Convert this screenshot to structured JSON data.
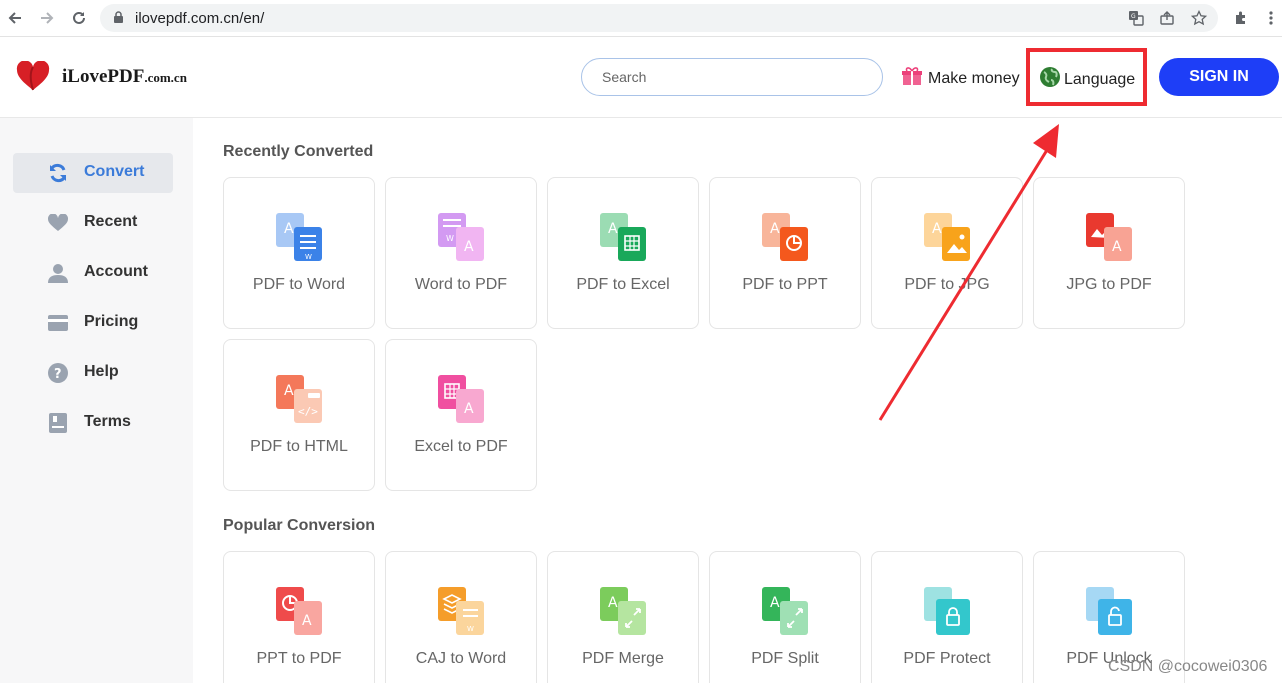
{
  "browser": {
    "url": "ilovepdf.com.cn/en/"
  },
  "header": {
    "logo_name": "iLovePDF",
    "logo_domain": ".com.cn",
    "search_placeholder": "Search",
    "make_money": "Make money",
    "language": "Language",
    "sign_in": "SIGN IN"
  },
  "sidebar": {
    "items": [
      {
        "label": "Convert",
        "icon": "refresh-icon"
      },
      {
        "label": "Recent",
        "icon": "heart-icon"
      },
      {
        "label": "Account",
        "icon": "user-icon"
      },
      {
        "label": "Pricing",
        "icon": "card-icon"
      },
      {
        "label": "Help",
        "icon": "help-icon"
      },
      {
        "label": "Terms",
        "icon": "document-icon"
      }
    ]
  },
  "main": {
    "recent_title": "Recently Converted",
    "recent": [
      {
        "label": "PDF to Word",
        "icon": "pdf-to-word-icon"
      },
      {
        "label": "Word to PDF",
        "icon": "word-to-pdf-icon"
      },
      {
        "label": "PDF to Excel",
        "icon": "pdf-to-excel-icon"
      },
      {
        "label": "PDF to PPT",
        "icon": "pdf-to-ppt-icon"
      },
      {
        "label": "PDF to JPG",
        "icon": "pdf-to-jpg-icon"
      },
      {
        "label": "JPG to PDF",
        "icon": "jpg-to-pdf-icon"
      },
      {
        "label": "PDF to HTML",
        "icon": "pdf-to-html-icon"
      },
      {
        "label": "Excel to PDF",
        "icon": "excel-to-pdf-icon"
      }
    ],
    "popular_title": "Popular Conversion",
    "popular": [
      {
        "label": "PPT to PDF",
        "icon": "ppt-to-pdf-icon"
      },
      {
        "label": "CAJ to Word",
        "icon": "caj-to-word-icon"
      },
      {
        "label": "PDF Merge",
        "icon": "pdf-merge-icon"
      },
      {
        "label": "PDF Split",
        "icon": "pdf-split-icon"
      },
      {
        "label": "PDF Protect",
        "icon": "pdf-protect-icon"
      },
      {
        "label": "PDF Unlock",
        "icon": "pdf-unlock-icon"
      }
    ]
  },
  "watermark": "CSDN @cocowei0306",
  "colors": {
    "accent_blue": "#1e3ef7",
    "active_blue": "#3b7bd9",
    "highlight_red": "#ee2b31"
  }
}
